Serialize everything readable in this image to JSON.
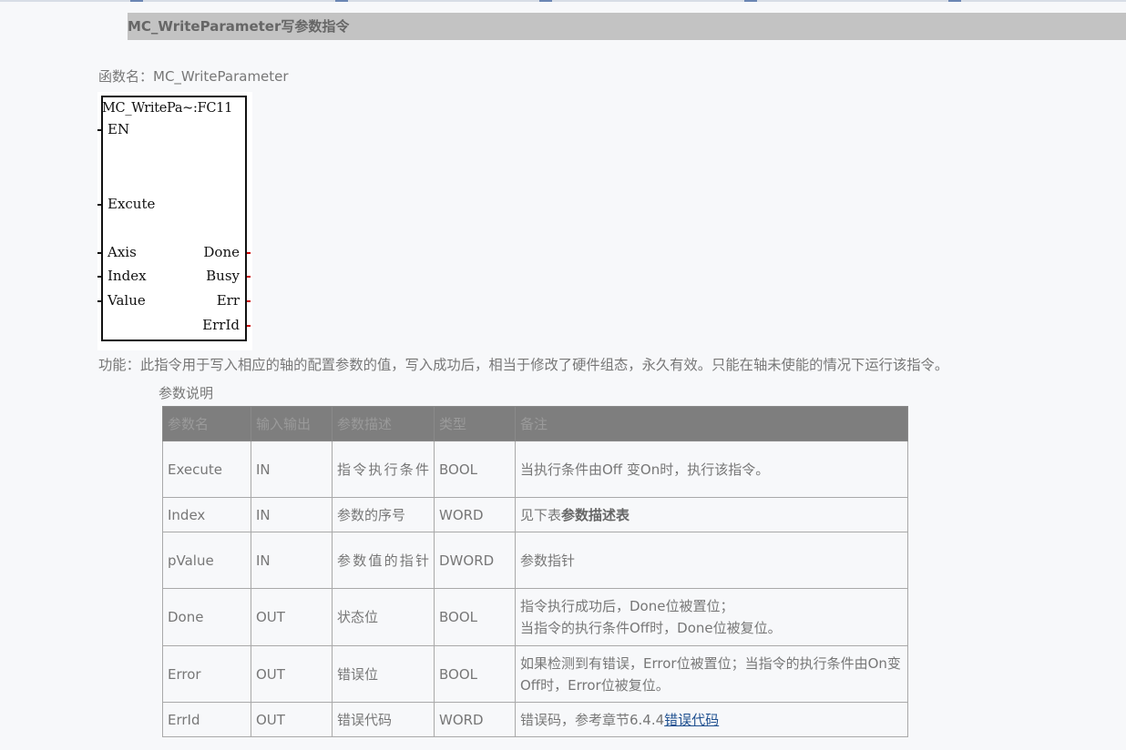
{
  "heading": "MC_WriteParameter写参数指令",
  "function_name_label": "函数名：MC_WriteParameter",
  "block": {
    "title": "MC_WritePa~:FC11",
    "inputs": [
      "EN",
      "Excute",
      "Axis",
      "Index",
      "Value"
    ],
    "outputs": [
      "Done",
      "Busy",
      "Err",
      "ErrId"
    ]
  },
  "function_desc": "功能：此指令用于写入相应的轴的配置参数的值，写入成功后，相当于修改了硬件组态，永久有效。只能在轴未使能的情况下运行该指令。",
  "table_caption": "参数说明",
  "table": {
    "headers": [
      "参数名",
      "输入输出",
      "参数描述",
      "类型",
      "备注"
    ],
    "rows": [
      {
        "name": "Execute",
        "io": "IN",
        "desc": "指令执行条件",
        "type": "BOOL",
        "note": "当执行条件由Off 变On时，执行该指令。"
      },
      {
        "name": "Index",
        "io": "IN",
        "desc": "参数的序号",
        "type": "WORD",
        "note_prefix": "见下表",
        "note_bold": "参数描述表"
      },
      {
        "name": "pValue",
        "io": "IN",
        "desc": "参数值的指针",
        "type": "DWORD",
        "note": "参数指针"
      },
      {
        "name": "Done",
        "io": "OUT",
        "desc": "状态位",
        "type": "BOOL",
        "note_line1": "指令执行成功后，Done位被置位；",
        "note_line2": "当指令的执行条件Off时，Done位被复位。"
      },
      {
        "name": "Error",
        "io": "OUT",
        "desc": "错误位",
        "type": "BOOL",
        "note": "如果检测到有错误，Error位被置位；当指令的执行条件由On变Off时，Error位被复位。"
      },
      {
        "name": "ErrId",
        "io": "OUT",
        "desc": "错误代码",
        "type": "WORD",
        "note_prefix": "错误码，参考章节6.4.4",
        "note_link": "错误代码"
      }
    ]
  }
}
